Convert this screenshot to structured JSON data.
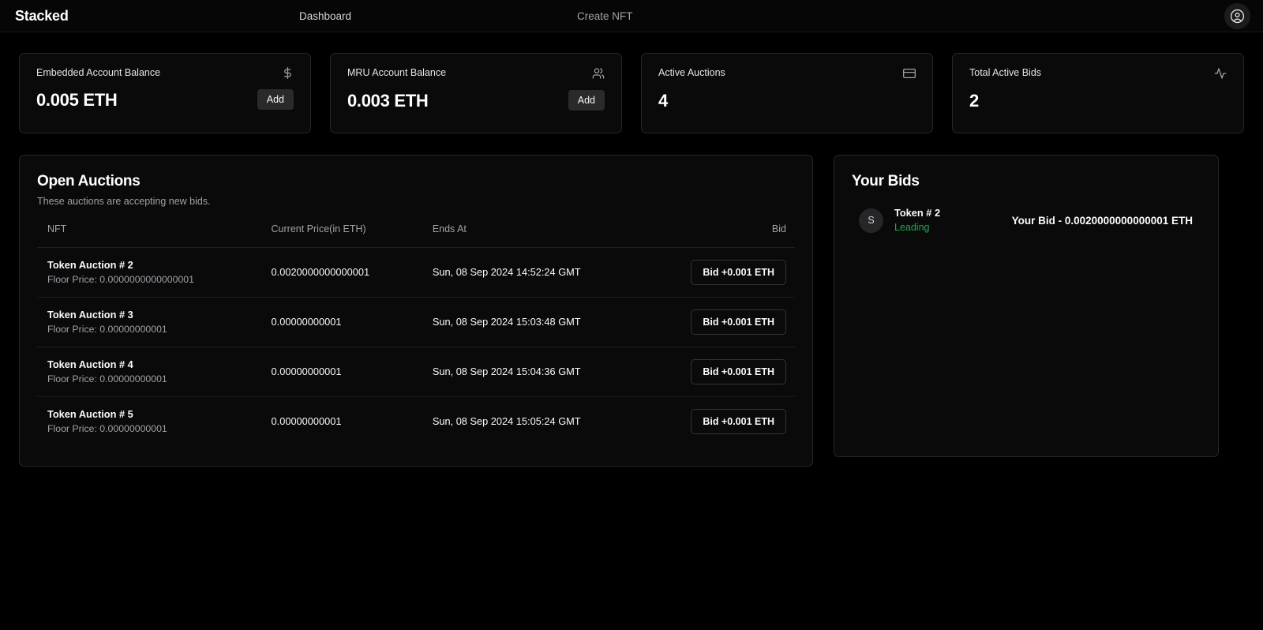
{
  "navbar": {
    "brand": "Stacked",
    "links": [
      {
        "label": "Dashboard",
        "name": "nav-link-dashboard"
      },
      {
        "label": "Create NFT",
        "name": "nav-link-create-nft"
      }
    ],
    "avatar_icon": "user-circle-icon"
  },
  "stats": [
    {
      "title": "Embedded Account Balance",
      "value": "0.005 ETH",
      "icon": "dollar-sign-icon",
      "action_label": "Add",
      "has_action": true
    },
    {
      "title": "MRU Account Balance",
      "value": "0.003 ETH",
      "icon": "users-icon",
      "action_label": "Add",
      "has_action": true
    },
    {
      "title": "Active Auctions",
      "value": "4",
      "icon": "credit-card-icon",
      "action_label": "",
      "has_action": false
    },
    {
      "title": "Total Active Bids",
      "value": "2",
      "icon": "activity-icon",
      "action_label": "",
      "has_action": false
    }
  ],
  "auctions": {
    "title": "Open Auctions",
    "subtitle": "These auctions are accepting new bids.",
    "columns": {
      "nft": "NFT",
      "price": "Current Price(in ETH)",
      "ends": "Ends At",
      "bid": "Bid"
    },
    "rows": [
      {
        "name": "Token Auction # 2",
        "floor": "Floor Price: 0.0000000000000001",
        "price": "0.0020000000000001",
        "ends": "Sun, 08 Sep 2024 14:52:24 GMT",
        "bid_label": "Bid +0.001 ETH"
      },
      {
        "name": "Token Auction # 3",
        "floor": "Floor Price: 0.00000000001",
        "price": "0.00000000001",
        "ends": "Sun, 08 Sep 2024 15:03:48 GMT",
        "bid_label": "Bid +0.001 ETH"
      },
      {
        "name": "Token Auction # 4",
        "floor": "Floor Price: 0.00000000001",
        "price": "0.00000000001",
        "ends": "Sun, 08 Sep 2024 15:04:36 GMT",
        "bid_label": "Bid +0.001 ETH"
      },
      {
        "name": "Token Auction # 5",
        "floor": "Floor Price: 0.00000000001",
        "price": "0.00000000001",
        "ends": "Sun, 08 Sep 2024 15:05:24 GMT",
        "bid_label": "Bid +0.001 ETH"
      }
    ]
  },
  "your_bids": {
    "title": "Your Bids",
    "items": [
      {
        "avatar_initial": "S",
        "token": "Token # 2",
        "status": "Leading",
        "status_color": "#22a84e",
        "amount": "Your Bid - 0.0020000000000001 ETH"
      }
    ]
  },
  "colors": {
    "background": "#000000",
    "card_background": "#0a0a0a",
    "card_border": "#27272a",
    "text_primary": "#ffffff",
    "text_muted": "#a1a1aa",
    "accent_green": "#22a84e"
  }
}
